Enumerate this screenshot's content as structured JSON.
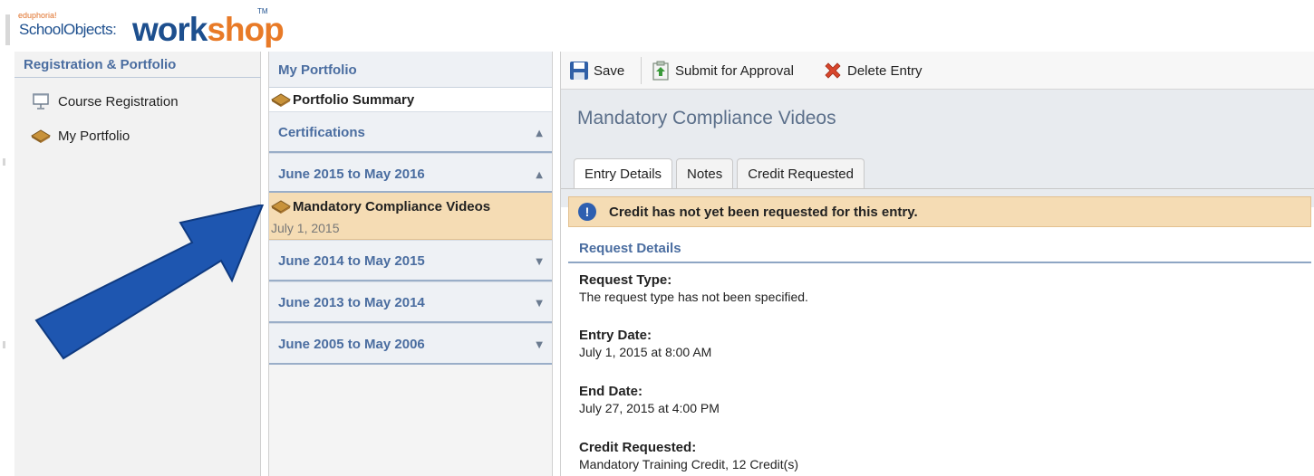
{
  "header": {
    "logo_small": "eduphoria!",
    "logo_product": "SchoolObjects:",
    "logo_work": "work",
    "logo_shop": "shop",
    "logo_tm": "TM"
  },
  "leftnav": {
    "title": "Registration & Portfolio",
    "items": [
      {
        "label": "Course Registration",
        "icon": "presentation-icon"
      },
      {
        "label": "My Portfolio",
        "icon": "portfolio-icon"
      }
    ]
  },
  "portfolio": {
    "title": "My Portfolio",
    "summary": "Portfolio Summary",
    "certifications": "Certifications",
    "groups": [
      {
        "label": "June 2015 to May 2016",
        "expanded": true
      },
      {
        "label": "June 2014 to May 2015",
        "expanded": false
      },
      {
        "label": "June 2013 to May 2014",
        "expanded": false
      },
      {
        "label": "June 2005 to May 2006",
        "expanded": false
      }
    ],
    "selected_entry": {
      "title": "Mandatory Compliance Videos",
      "date": "July 1, 2015"
    }
  },
  "toolbar": {
    "save": "Save",
    "submit": "Submit for Approval",
    "delete": "Delete Entry"
  },
  "detail": {
    "title": "Mandatory Compliance Videos",
    "tabs": [
      "Entry Details",
      "Notes",
      "Credit Requested"
    ],
    "notice": "Credit has not yet been requested for this entry.",
    "section": "Request Details",
    "fields": [
      {
        "label": "Request Type:",
        "value": "The request type has not been specified."
      },
      {
        "label": "Entry Date:",
        "value": "July 1, 2015 at 8:00 AM"
      },
      {
        "label": "End Date:",
        "value": "July 27, 2015 at 4:00 PM"
      },
      {
        "label": "Credit Requested:",
        "value": "Mandatory Training Credit, 12 Credit(s)"
      }
    ]
  },
  "colors": {
    "accent": "#4a6da0",
    "selected": "#f5dcb4",
    "arrow": "#1e56b0"
  }
}
